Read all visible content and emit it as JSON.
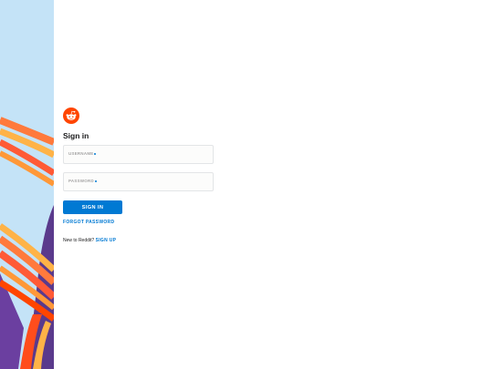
{
  "form": {
    "title": "Sign in",
    "username_label": "USERNAME",
    "password_label": "PASSWORD",
    "submit_label": "SIGN IN",
    "forgot_label": "FORGOT PASSWORD",
    "signup_prompt": "New to Reddit?",
    "signup_label": "SIGN UP"
  },
  "icons": {
    "logo": "reddit-logo-icon",
    "required_marker": "dot-icon"
  },
  "colors": {
    "brand": "#ff4500",
    "accent": "#0079d3",
    "side_background": "#c4e3f7"
  }
}
